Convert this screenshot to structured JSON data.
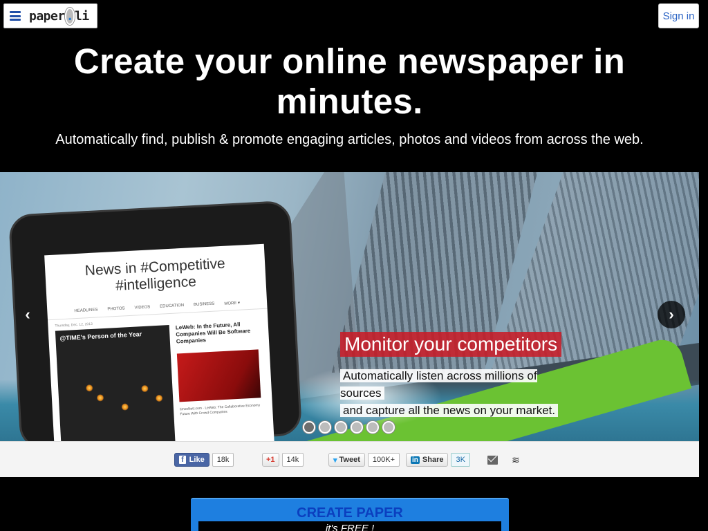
{
  "header": {
    "logo_text_a": "paper",
    "logo_text_dot": ".",
    "logo_text_b": "li",
    "signin_label": "Sign in"
  },
  "hero": {
    "title": "Create your online newspaper in minutes.",
    "subtitle": "Automatically find, publish & promote engaging articles, photos and videos from across the web."
  },
  "carousel": {
    "caption_title": "Monitor your competitors",
    "caption_line1": "Automatically listen across millions of sources",
    "caption_line2": "and capture all the news on your market.",
    "prev_label": "‹",
    "next_label": "›",
    "active_slide": 1,
    "slide_count": 6,
    "tablet": {
      "title": "News in #Competitive #intelligence",
      "nav": [
        "HEADLINES",
        "PHOTOS",
        "VIDEOS",
        "EDUCATION",
        "BUSINESS",
        "MORE ▾"
      ],
      "meta": "Thursday, Dec. 12, 2013",
      "left_caption": "@TIME's Person of the Year",
      "right_caption": "LeWeb: In the Future, All Companies Will Be Software Companies",
      "right_small": "timoelliott.com · LeWeb: The Collaborative Economy Future With Crowd Companies"
    }
  },
  "share": {
    "facebook": {
      "label": "Like",
      "count": "18k"
    },
    "gplus": {
      "label": "+1",
      "count": "14k"
    },
    "twitter": {
      "label": "Tweet",
      "count": "100K+"
    },
    "linkedin": {
      "label": "Share",
      "count": "3K"
    }
  },
  "cta": {
    "create_label": "CREATE PAPER",
    "free_label": "it's FREE !"
  },
  "colors": {
    "accent_red": "#c81c28",
    "cta_blue": "#1e7fe0",
    "link_blue": "#2a63c4"
  }
}
